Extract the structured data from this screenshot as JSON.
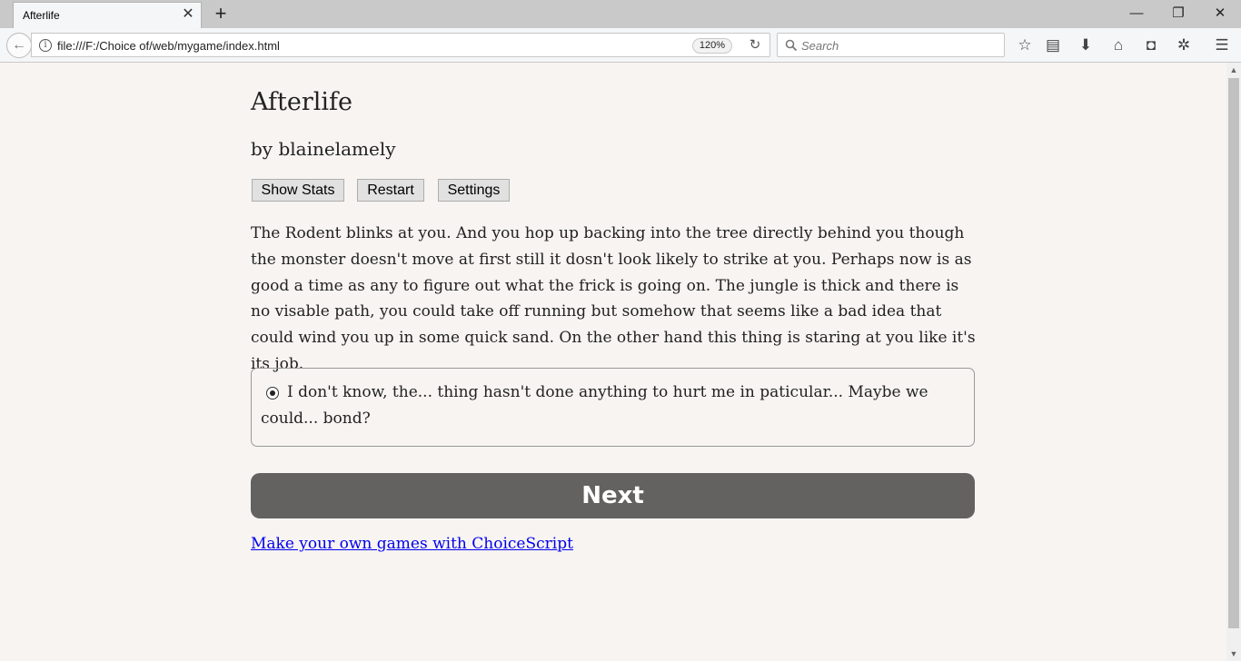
{
  "browser": {
    "tab_title": "Afterlife",
    "tab_close": "✕",
    "new_tab": "+",
    "window_controls": {
      "minimize": "—",
      "restore": "❐",
      "close": "✕"
    },
    "back": "←",
    "url": "file:///F:/Choice of/web/mygame/index.html",
    "zoom": "120%",
    "reload": "↻",
    "search_placeholder": "Search",
    "toolbar_icons": [
      "star-icon",
      "reading-list-icon",
      "download-icon",
      "home-icon",
      "pocket-icon",
      "extension-icon",
      "menu-icon"
    ]
  },
  "game": {
    "title": "Afterlife",
    "author": "by blainelamely",
    "buttons": {
      "show_stats": "Show Stats",
      "restart": "Restart",
      "settings": "Settings"
    },
    "story_text": "The Rodent blinks at you. And you hop up backing into the tree directly behind you though the monster doesn't move at first still it dosn't look likely to strike at you. Perhaps now is as good a time as any to figure out what the frick is going on. The jungle is thick and there is no visable path, you could take off running but somehow that seems like a bad idea that could wind you up in some quick sand. On the other hand this thing is staring at you like it's its job.",
    "choice": {
      "text": "I don't know, the... thing hasn't done anything to hurt me in paticular... Maybe we could... bond?",
      "selected": true
    },
    "next_label": "Next",
    "footer_link": "Make your own games with ChoiceScript"
  }
}
